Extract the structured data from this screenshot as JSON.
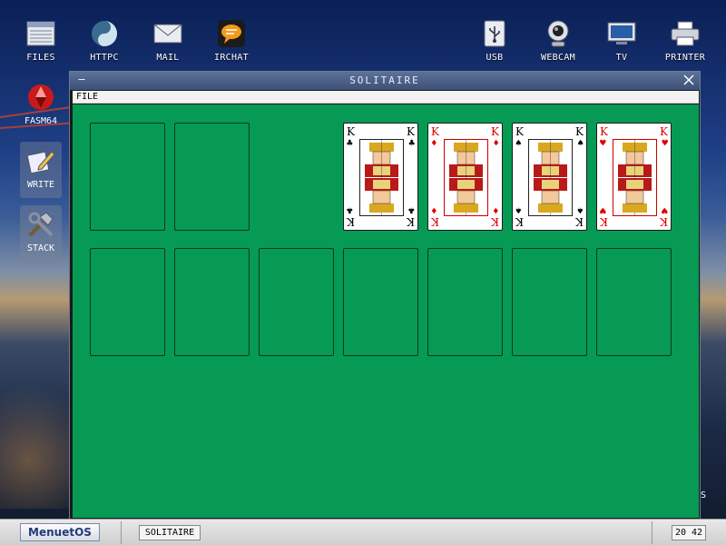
{
  "desktop": {
    "top_icons": [
      {
        "label": "FILES",
        "icon": "files-icon"
      },
      {
        "label": "HTTPC",
        "icon": "httpc-icon"
      },
      {
        "label": "MAIL",
        "icon": "mail-icon"
      },
      {
        "label": "IRCHAT",
        "icon": "irchat-icon"
      },
      {
        "label": "USB",
        "icon": "usb-icon"
      },
      {
        "label": "WEBCAM",
        "icon": "webcam-icon"
      },
      {
        "label": "TV",
        "icon": "tv-icon"
      },
      {
        "label": "PRINTER",
        "icon": "printer-icon"
      }
    ],
    "side_icons": [
      {
        "label": "FASM64",
        "icon": "fasm64-icon"
      },
      {
        "label": "WRITE",
        "icon": "write-icon"
      },
      {
        "label": "STACK",
        "icon": "stack-icon"
      }
    ],
    "edge_text": "S"
  },
  "window": {
    "title": "SOLITAIRE",
    "menu": {
      "file": "FILE"
    }
  },
  "game": {
    "foundation_kings": [
      {
        "rank": "K",
        "suit": "♣",
        "color": "#000000"
      },
      {
        "rank": "K",
        "suit": "♦",
        "color": "#e00000"
      },
      {
        "rank": "K",
        "suit": "♠",
        "color": "#000000"
      },
      {
        "rank": "K",
        "suit": "♥",
        "color": "#e00000"
      }
    ],
    "table_color": "#069a55"
  },
  "taskbar": {
    "start_label": "MenuetOS",
    "task_label": "SOLITAIRE",
    "clock": "20 42"
  }
}
